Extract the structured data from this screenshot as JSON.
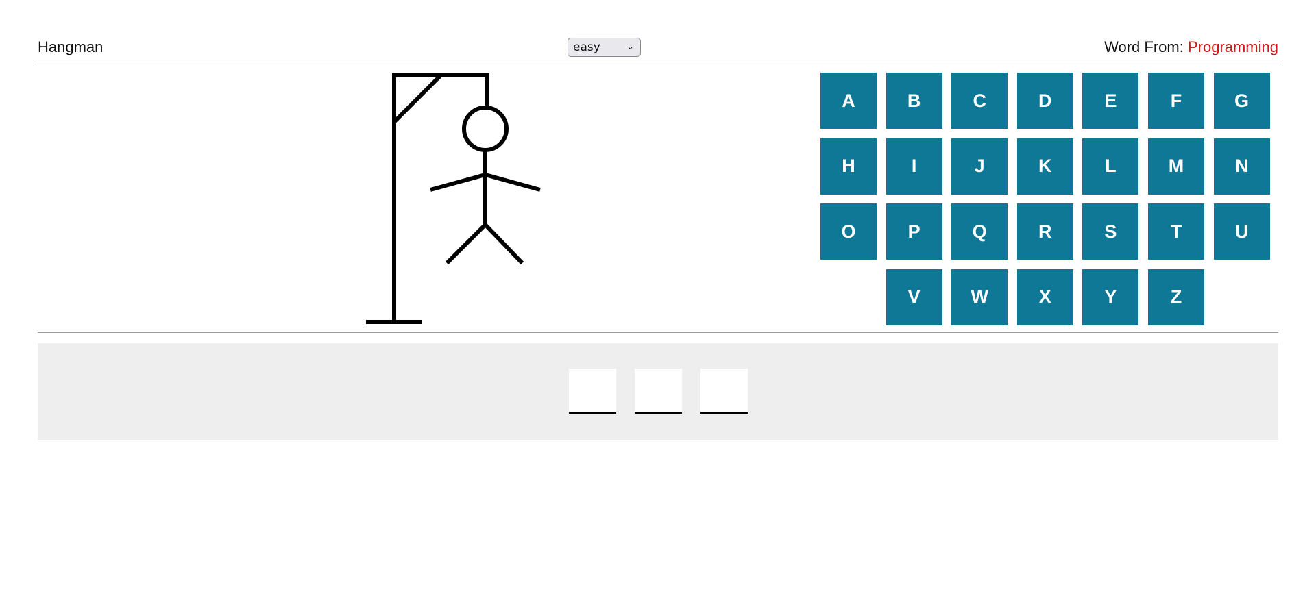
{
  "header": {
    "title": "Hangman",
    "difficulty": {
      "selected": "easy",
      "icon": "chevron-down-icon"
    },
    "word_from_label": "Word From:",
    "word_from_category": "Programming",
    "category_color": "#d0181b"
  },
  "hangman": {
    "parts_shown": [
      "base",
      "pole",
      "beam",
      "brace",
      "rope",
      "head",
      "body",
      "left-arm",
      "right-arm",
      "left-leg",
      "right-leg"
    ]
  },
  "keyboard": {
    "tile_color": "#107897",
    "letters": [
      "A",
      "B",
      "C",
      "D",
      "E",
      "F",
      "G",
      "H",
      "I",
      "J",
      "K",
      "L",
      "M",
      "N",
      "O",
      "P",
      "Q",
      "R",
      "S",
      "T",
      "U",
      "V",
      "W",
      "X",
      "Y",
      "Z"
    ]
  },
  "word": {
    "slots": [
      "",
      "",
      ""
    ]
  }
}
